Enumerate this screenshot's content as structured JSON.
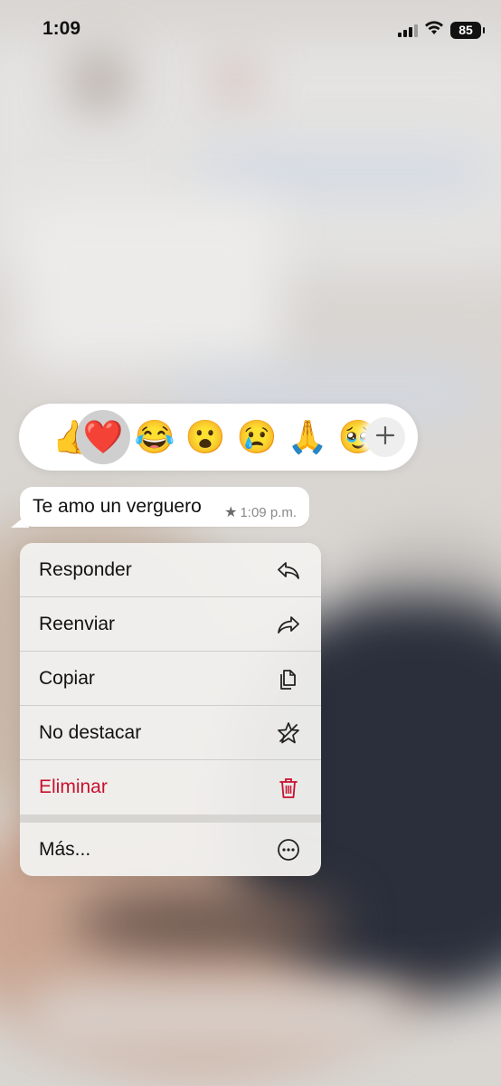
{
  "status_bar": {
    "time": "1:09",
    "battery": "85"
  },
  "reactions": {
    "items": [
      {
        "emoji": "👍",
        "name": "thumbs-up",
        "selected": false
      },
      {
        "emoji": "❤️",
        "name": "heart",
        "selected": true
      },
      {
        "emoji": "😂",
        "name": "laughing",
        "selected": false
      },
      {
        "emoji": "😮",
        "name": "surprised",
        "selected": false
      },
      {
        "emoji": "😢",
        "name": "crying",
        "selected": false
      },
      {
        "emoji": "🙏",
        "name": "praying-hands",
        "selected": false
      },
      {
        "emoji": "🥹",
        "name": "holding-back-tears",
        "selected": false
      }
    ],
    "more_icon": "plus-icon"
  },
  "message": {
    "text": "Te amo un verguero",
    "star": "★",
    "time": "1:09 p.m."
  },
  "menu": {
    "items": [
      {
        "label": "Responder",
        "icon": "reply-icon"
      },
      {
        "label": "Reenviar",
        "icon": "forward-icon"
      },
      {
        "label": "Copiar",
        "icon": "copy-icon"
      },
      {
        "label": "No destacar",
        "icon": "unstar-icon"
      },
      {
        "label": "Eliminar",
        "icon": "trash-icon",
        "color": "#c8102e"
      },
      {
        "label": "Más...",
        "icon": "more-icon"
      }
    ]
  }
}
